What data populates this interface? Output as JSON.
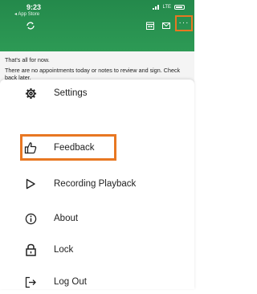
{
  "status_bar": {
    "time": "9:23",
    "back_label": "◂ App Store",
    "network": "LTE"
  },
  "toolbar": {
    "icons": [
      "refresh-icon",
      "calendar-icon",
      "message-icon",
      "more-icon"
    ],
    "more_label": "···"
  },
  "notice": {
    "line1": "That's all for now.",
    "line2": "There are no appointments today or notes to review and sign. Check back later."
  },
  "menu": {
    "items": [
      {
        "label": "Settings",
        "icon": "gear-icon"
      },
      {
        "label": "Feedback",
        "icon": "thumbs-up-icon",
        "highlighted": true
      },
      {
        "label": "Recording Playback",
        "icon": "play-icon"
      },
      {
        "label": "About",
        "icon": "info-icon"
      },
      {
        "label": "Lock",
        "icon": "lock-icon"
      },
      {
        "label": "Log Out",
        "icon": "logout-icon"
      }
    ]
  },
  "colors": {
    "header": "#2d9a55",
    "highlight": "#e87722"
  }
}
